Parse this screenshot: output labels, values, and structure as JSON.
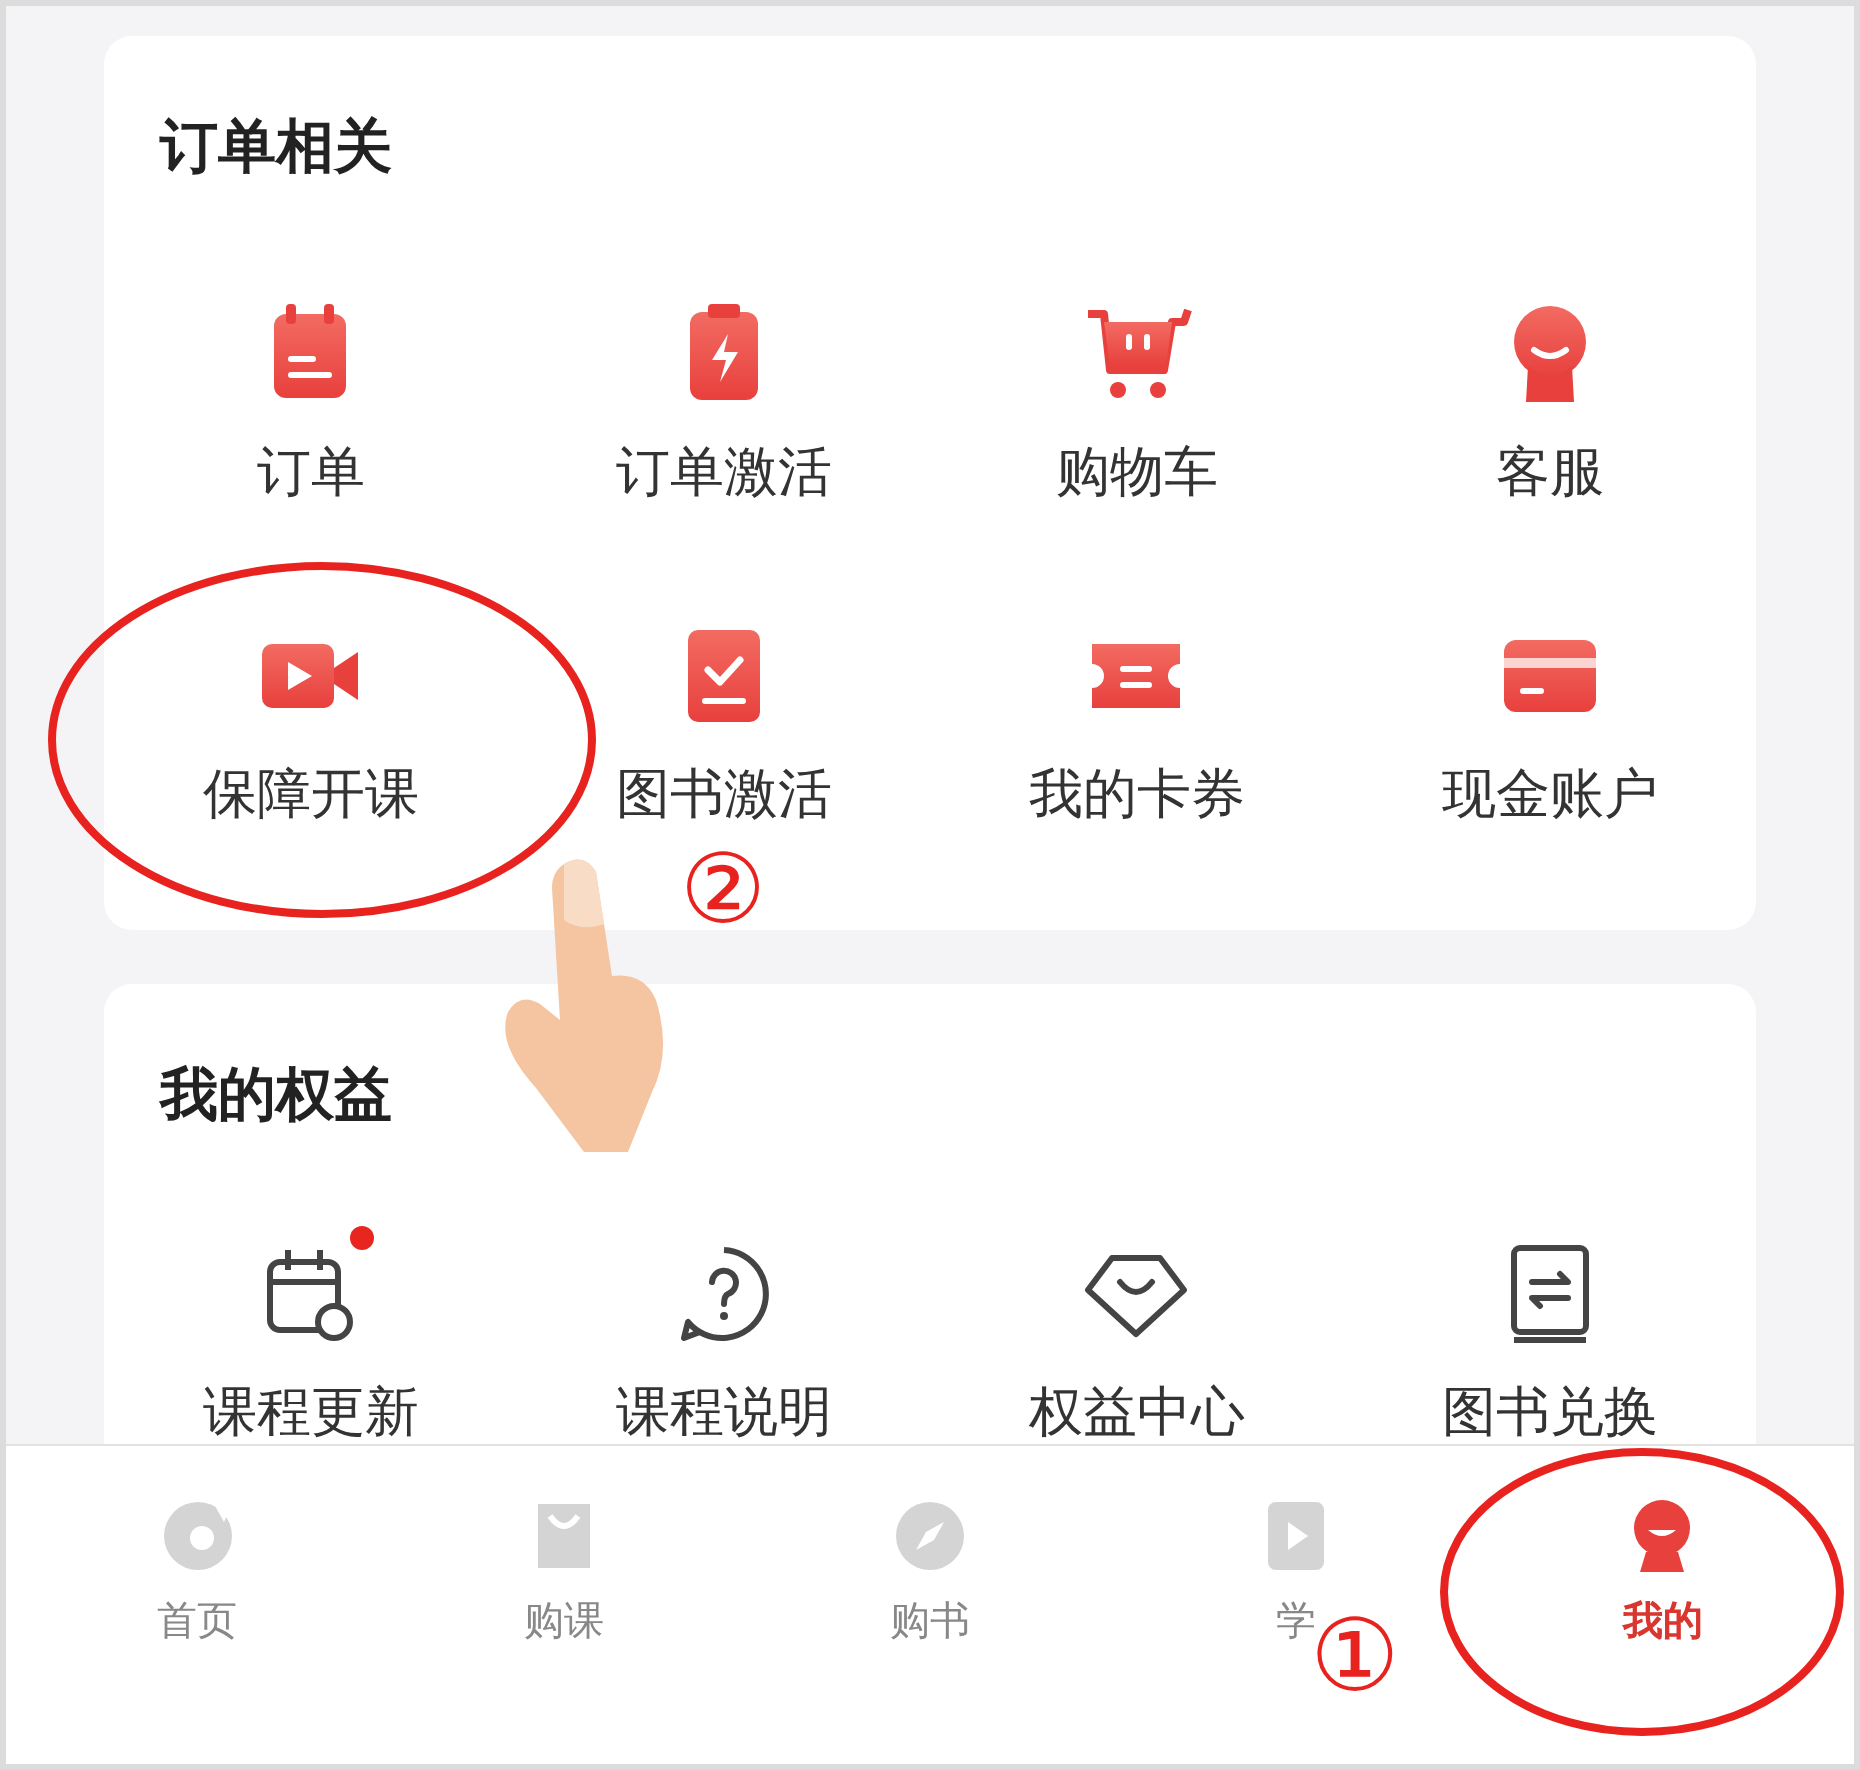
{
  "sections": [
    {
      "title": "订单相关",
      "items": [
        {
          "label": "订单",
          "dot": false
        },
        {
          "label": "订单激活",
          "dot": false
        },
        {
          "label": "购物车",
          "dot": false
        },
        {
          "label": "客服",
          "dot": false
        },
        {
          "label": "保障开课",
          "dot": false
        },
        {
          "label": "图书激活",
          "dot": false
        },
        {
          "label": "我的卡券",
          "dot": false
        },
        {
          "label": "现金账户",
          "dot": false
        }
      ]
    },
    {
      "title": "我的权益",
      "items": [
        {
          "label": "课程更新",
          "dot": true
        },
        {
          "label": "课程说明",
          "dot": false
        },
        {
          "label": "权益中心",
          "dot": false
        },
        {
          "label": "图书兑换",
          "dot": false
        }
      ]
    }
  ],
  "tabs": [
    {
      "label": "首页",
      "selected": false
    },
    {
      "label": "购课",
      "selected": false
    },
    {
      "label": "购书",
      "selected": false
    },
    {
      "label": "学",
      "selected": false
    },
    {
      "label": "我的",
      "selected": true
    }
  ],
  "annotations": [
    {
      "label": "②"
    },
    {
      "label": "①"
    }
  ]
}
